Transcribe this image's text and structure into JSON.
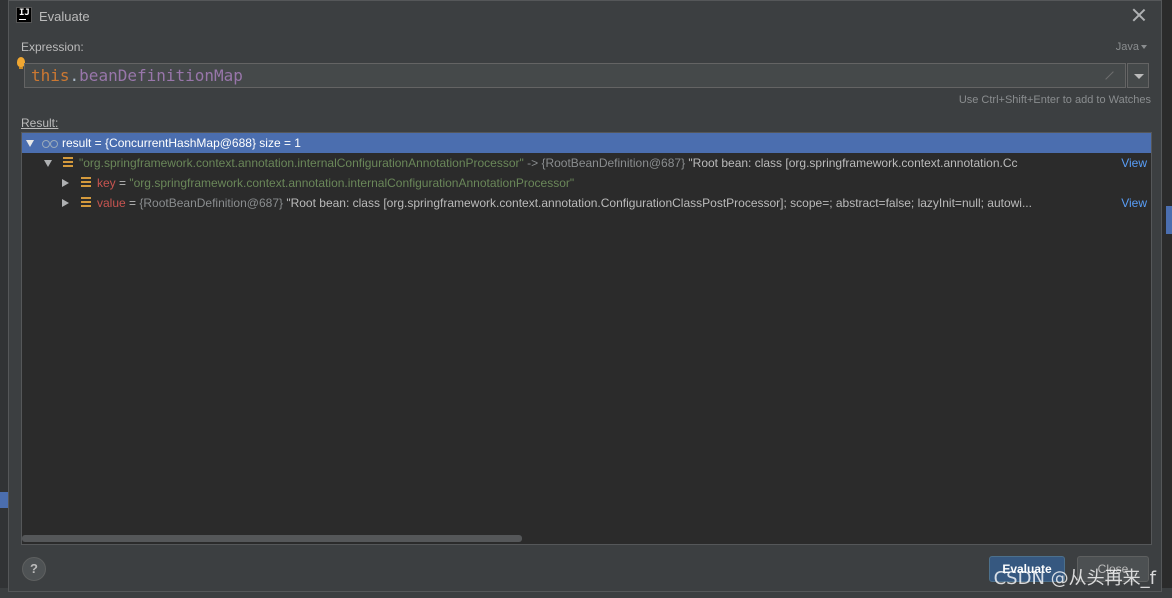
{
  "window": {
    "title": "Evaluate",
    "app_icon_text": "IJ"
  },
  "expression": {
    "label": "Expression:",
    "language": "Java",
    "keyword": "this",
    "dot": ".",
    "field": "beanDefinitionMap",
    "hint": "Use Ctrl+Shift+Enter to add to Watches"
  },
  "result": {
    "label": "Result:",
    "root": "result = {ConcurrentHashMap@688}  size = 1",
    "entry": {
      "key_str": "\"org.springframework.context.annotation.internalConfigurationAnnotationProcessor\"",
      "arrow": " -> ",
      "ref": "{RootBeanDefinition@687}",
      "desc": " \"Root bean: class [org.springframework.context.annotation.Cc",
      "view": "View"
    },
    "key_row": {
      "name": "key",
      "eq": " = ",
      "value": "\"org.springframework.context.annotation.internalConfigurationAnnotationProcessor\""
    },
    "value_row": {
      "name": "value",
      "eq": " = ",
      "ref": "{RootBeanDefinition@687}",
      "desc": " \"Root bean: class [org.springframework.context.annotation.ConfigurationClassPostProcessor]; scope=; abstract=false; lazyInit=null; autowi...",
      "view": "View"
    }
  },
  "buttons": {
    "help": "?",
    "evaluate": "Evaluate",
    "close": "Close"
  },
  "watermark": "CSDN @从头再来_f",
  "colors": {
    "accent": "#4b6eaf",
    "evaluate_btn": "#365880",
    "keyword": "#cc7832",
    "field": "#9876aa",
    "string": "#6a8759",
    "link": "#589df6"
  }
}
